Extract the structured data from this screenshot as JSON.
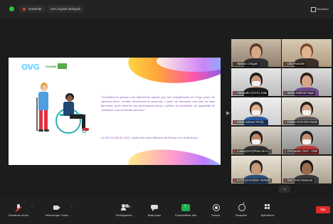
{
  "topbar": {
    "recording_label": "Gravando",
    "sound_label": "Som original desligado",
    "view_label": "Visualizar"
  },
  "slide": {
    "logo_text_1": "OV",
    "logo_text_2": "G",
    "logo_partner": "UNDIME",
    "quote": "“Considera-se pessoa com deficiência aquela que tem impedimento de longo prazo de natureza física, mental, intelectual ou sensorial, o qual, em interação com uma ou mais barreiras, pode obstruir sua participação plena e efetiva na sociedade em igualdade de condições com as demais pessoas.”",
    "source": "Lei No 13.146 de 2015, conhecida como Estatuto da Pessoa com Deficiência"
  },
  "participants": [
    {
      "name": "Tatiana Chagas",
      "muted": false
    },
    {
      "name": "Lilia Parande",
      "muted": false,
      "active": true
    },
    {
      "name": "Alexandre (OVG) Jatai",
      "muted": true
    },
    {
      "name": "Maria Helena/ Fapá",
      "muted": true
    },
    {
      "name": "Silvia Helena/ OVG(...",
      "muted": true
    },
    {
      "name": "Elaine-OVG-Rio Verde",
      "muted": true
    },
    {
      "name": "Luana(OVG)Pires do R...",
      "muted": true
    },
    {
      "name": "Fernanda- OVG - CRE",
      "muted": true
    },
    {
      "name": "KATIA(OVG)RIO VERDE",
      "muted": true
    },
    {
      "name": "Beri-OVG Mineiros",
      "muted": true
    }
  ],
  "toolbar": {
    "mic_label": "Desativar mudo",
    "video_label": "Interromper Vídeo",
    "participants_label": "Participantes",
    "participants_count": "95",
    "chat_label": "Bate-papo",
    "share_label": "Compartilhar tela",
    "record_label": "Gravar",
    "reactions_label": "Reações",
    "apps_label": "Aplicativos",
    "leave_label": "Sair"
  },
  "colors": {
    "accent_green": "#1fae4b",
    "leave_red": "#e02a2a",
    "active_speaker": "#d7e94a",
    "quote_purple": "#7a48b8"
  }
}
